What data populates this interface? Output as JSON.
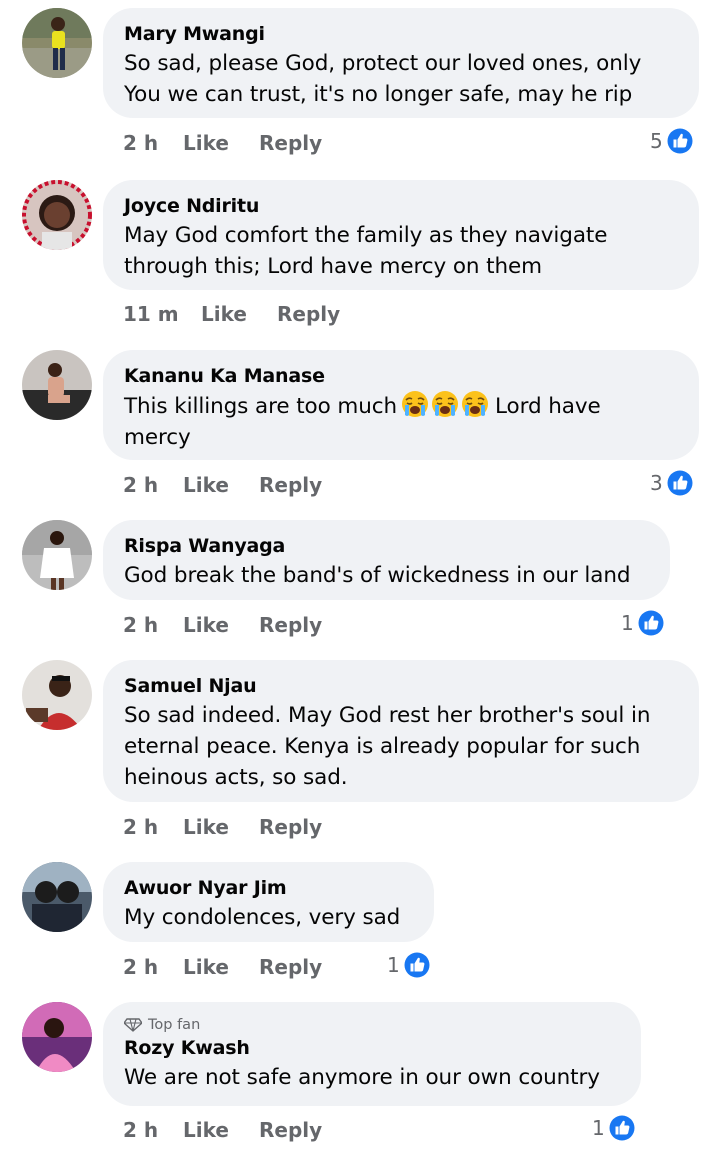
{
  "colors": {
    "bubble_bg": "#f0f2f5",
    "meta_text": "#65676b",
    "like_blue": "#1877f2"
  },
  "comments": [
    {
      "author": "Mary Mwangi",
      "lines": [
        "So sad, please God, protect our loved ones, only",
        "You we can trust, it's no longer safe, may he rip"
      ],
      "time": "2 h",
      "like": "Like",
      "reply": "Reply",
      "reactions": "5",
      "reaction_icon": "thumbs-up-icon"
    },
    {
      "author": "Joyce Ndiritu",
      "lines": [
        "May God comfort the family as they navigate",
        "through this; Lord have mercy on them"
      ],
      "time": "11 m",
      "like": "Like",
      "reply": "Reply"
    },
    {
      "author": "Kananu Ka Manase",
      "line1_before": "This killings are too much",
      "line1_after": "Lord have",
      "line2": "mercy",
      "emojis": [
        "loudly-crying-face-icon",
        "loudly-crying-face-icon",
        "loudly-crying-face-icon"
      ],
      "time": "2 h",
      "like": "Like",
      "reply": "Reply",
      "reactions": "3",
      "reaction_icon": "thumbs-up-icon"
    },
    {
      "author": "Rispa Wanyaga",
      "lines": [
        "God break the band's of wickedness in our land"
      ],
      "time": "2 h",
      "like": "Like",
      "reply": "Reply",
      "reactions": "1",
      "reaction_icon": "thumbs-up-icon"
    },
    {
      "author": "Samuel Njau",
      "lines": [
        "So sad indeed. May God rest her brother's soul in",
        "eternal peace. Kenya is already popular for such",
        "heinous acts, so sad."
      ],
      "time": "2 h",
      "like": "Like",
      "reply": "Reply"
    },
    {
      "author": "Awuor Nyar Jim",
      "lines": [
        "My condolences, very sad"
      ],
      "time": "2 h",
      "like": "Like",
      "reply": "Reply",
      "reactions": "1",
      "reaction_icon": "thumbs-up-icon"
    },
    {
      "author": "Rozy Kwash",
      "badge": "Top fan",
      "badge_icon": "diamond-icon",
      "lines": [
        "We are not safe anymore in our own country"
      ],
      "time": "2 h",
      "like": "Like",
      "reply": "Reply",
      "reactions": "1",
      "reaction_icon": "thumbs-up-icon"
    }
  ]
}
